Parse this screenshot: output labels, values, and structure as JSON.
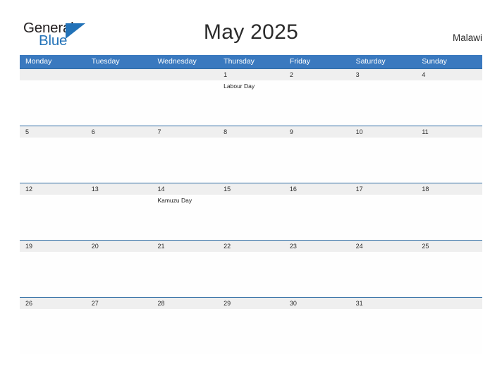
{
  "brand": {
    "name_part1": "General",
    "name_part2": "Blue",
    "color_dark": "#231f20",
    "color_blue": "#2272b8"
  },
  "header": {
    "title": "May 2025",
    "country": "Malawi"
  },
  "theme": {
    "header_blue": "#3a79bf",
    "row_divider_blue": "#2e6ca4",
    "date_band_gray": "#efefef",
    "page_background": "#ffffff"
  },
  "calendar": {
    "weekday_headers": [
      "Monday",
      "Tuesday",
      "Wednesday",
      "Thursday",
      "Friday",
      "Saturday",
      "Sunday"
    ],
    "weeks": [
      {
        "days": [
          {
            "date": "",
            "event": ""
          },
          {
            "date": "",
            "event": ""
          },
          {
            "date": "",
            "event": ""
          },
          {
            "date": "1",
            "event": "Labour Day"
          },
          {
            "date": "2",
            "event": ""
          },
          {
            "date": "3",
            "event": ""
          },
          {
            "date": "4",
            "event": ""
          }
        ]
      },
      {
        "days": [
          {
            "date": "5",
            "event": ""
          },
          {
            "date": "6",
            "event": ""
          },
          {
            "date": "7",
            "event": ""
          },
          {
            "date": "8",
            "event": ""
          },
          {
            "date": "9",
            "event": ""
          },
          {
            "date": "10",
            "event": ""
          },
          {
            "date": "11",
            "event": ""
          }
        ]
      },
      {
        "days": [
          {
            "date": "12",
            "event": ""
          },
          {
            "date": "13",
            "event": ""
          },
          {
            "date": "14",
            "event": "Kamuzu Day"
          },
          {
            "date": "15",
            "event": ""
          },
          {
            "date": "16",
            "event": ""
          },
          {
            "date": "17",
            "event": ""
          },
          {
            "date": "18",
            "event": ""
          }
        ]
      },
      {
        "days": [
          {
            "date": "19",
            "event": ""
          },
          {
            "date": "20",
            "event": ""
          },
          {
            "date": "21",
            "event": ""
          },
          {
            "date": "22",
            "event": ""
          },
          {
            "date": "23",
            "event": ""
          },
          {
            "date": "24",
            "event": ""
          },
          {
            "date": "25",
            "event": ""
          }
        ]
      },
      {
        "days": [
          {
            "date": "26",
            "event": ""
          },
          {
            "date": "27",
            "event": ""
          },
          {
            "date": "28",
            "event": ""
          },
          {
            "date": "29",
            "event": ""
          },
          {
            "date": "30",
            "event": ""
          },
          {
            "date": "31",
            "event": ""
          },
          {
            "date": "",
            "event": ""
          }
        ]
      }
    ]
  }
}
